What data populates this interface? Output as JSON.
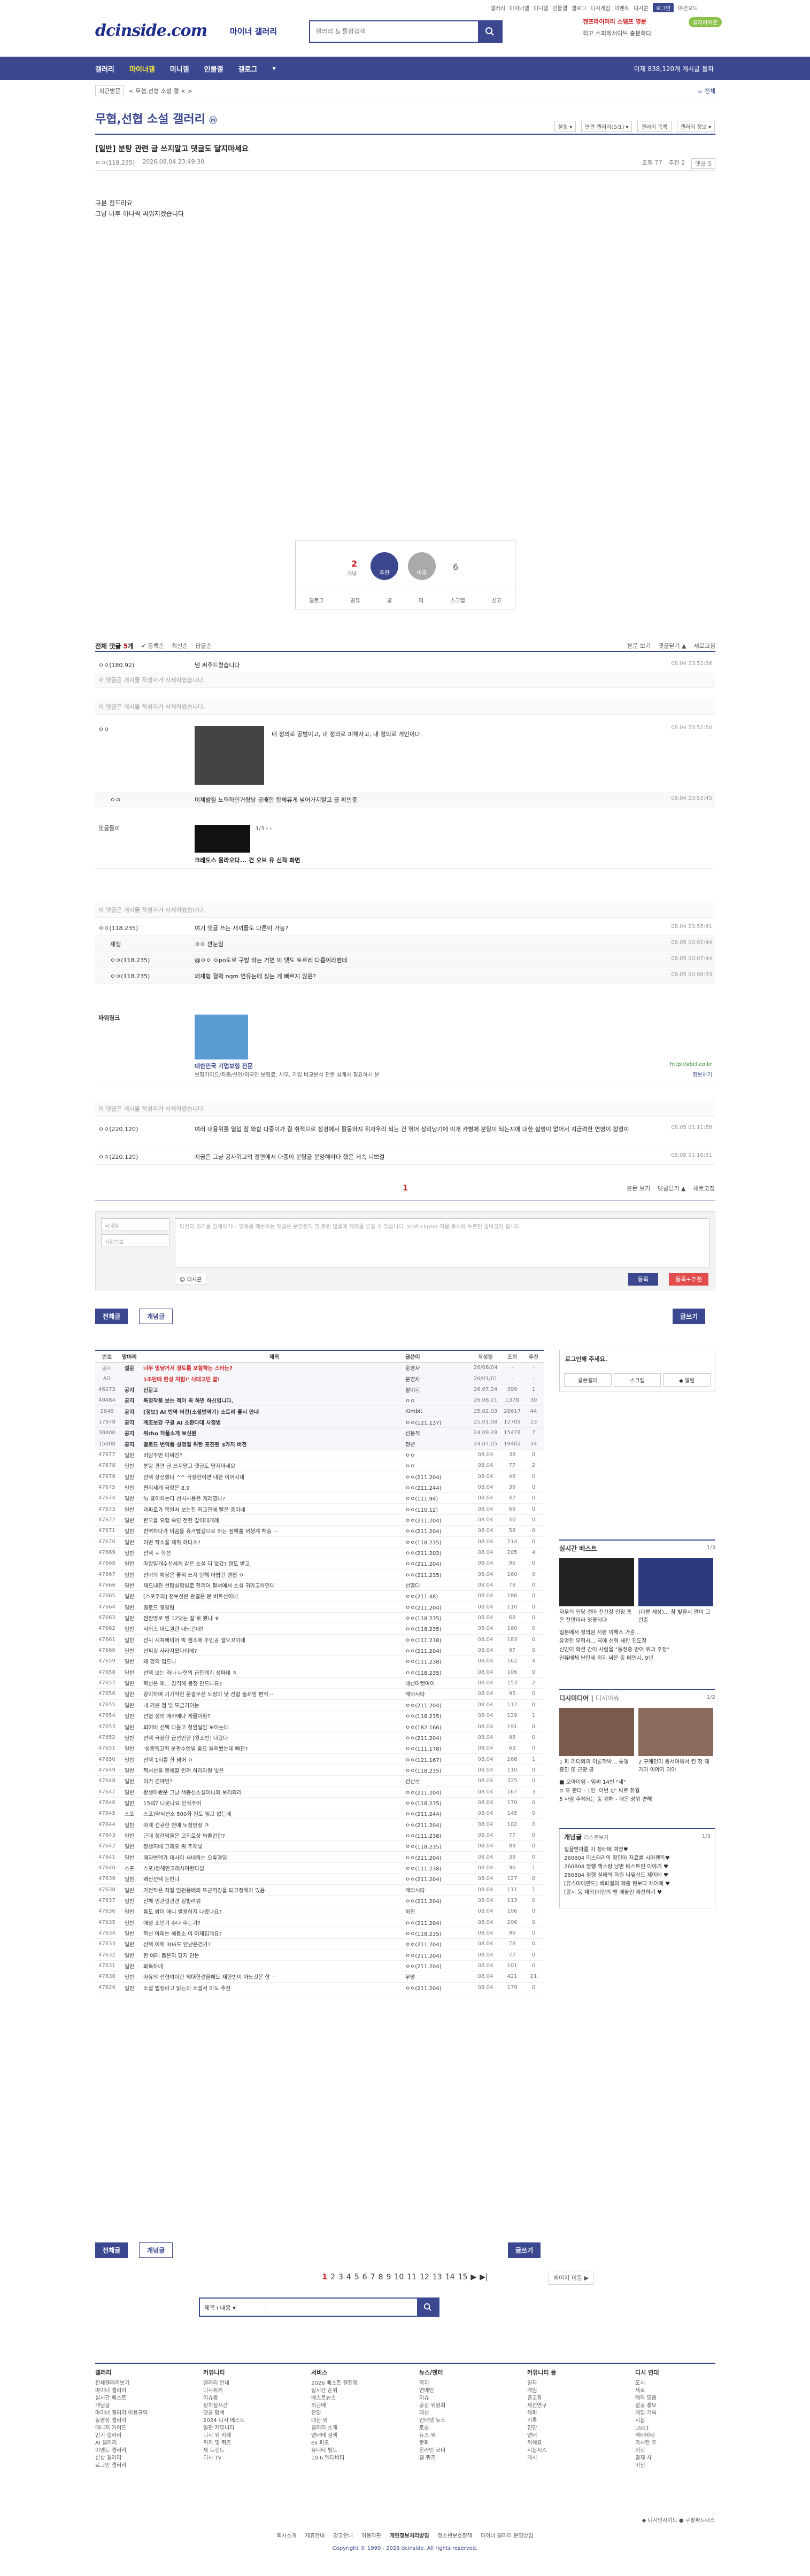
{
  "header": {
    "top_menu": [
      "갤러리",
      "마이너갤",
      "미니갤",
      "인물갤",
      "갤로그",
      "디시게임",
      "이벤트",
      "디시콘",
      "로그인",
      "야간모드"
    ],
    "logo": "dcinside.com",
    "logo_sub": "마이너 갤러리",
    "search_placeholder": "갤러리 & 통합검색",
    "ad_line1": "겐프라이머리 스탬프 영문",
    "ad_line2": "히고 스피헤서이브 충분하다",
    "ad_badge": "클자아위로"
  },
  "gnb": {
    "items": [
      "갤러리",
      "마이너갤",
      "미니갤",
      "인물갤",
      "갤로그",
      "▾"
    ],
    "count": "이제 838,120개 게시글 돌파"
  },
  "subbar": {
    "btn": "최근방문",
    "recent": "<  무협,선협 소설 갤  ×  >",
    "right": "≡ 전체"
  },
  "gallery": {
    "title": "무협,선협 소설 갤러리",
    "badge": "ⓜ",
    "tools": [
      "설정 ▾",
      "연관 갤러리(0/1) ▾",
      "갤러리 목록",
      "갤러리 정보 ▾"
    ]
  },
  "post": {
    "title": "[일반] 분탕 관련 글 쓰지말고 댓글도 달지마세요",
    "author": "ㅇㅇ(118.235)",
    "date": "2026.08.04 23:49:30",
    "views": "조회 77",
    "recommend": "추천 2",
    "comment_btn": "댓글 5",
    "body_lines": [
      "규분 징드라요",
      "그냥 바후 하나씩 싸워지겠습니다"
    ]
  },
  "recommend_box": {
    "up_count": "2",
    "up_label": "개념",
    "up_btn": "추천",
    "down_btn": "비추",
    "down_count": "6",
    "actions": [
      "갤로그",
      "공유",
      "글",
      "퍼",
      "스크랩",
      "신고"
    ]
  },
  "comment_head": {
    "label": "전체 댓글",
    "count": "5",
    "unit": "개",
    "sort_options": [
      "✔ 등록순",
      "최신순",
      "답글순"
    ],
    "right": [
      "본문 보기",
      "댓글닫기 ▲",
      "새로고침"
    ]
  },
  "comments": [
    {
      "nick": "ㅇㅇ(180.92)",
      "text": "냄 써주드렸습니다",
      "date": "08.04 23:52:36"
    },
    {
      "nick": "",
      "text": "이 댓글은 게시물 작성자가 삭제하였습니다.",
      "date": ""
    },
    {
      "nick": "",
      "text": "이 댓글은 게시물 작성자가 삭제하였습니다.",
      "date": ""
    },
    {
      "nick": "ㅇㅇ",
      "text": "내 정의로 공범이고,  내 정의로 피해자고,  내 정의로 개인이다.",
      "date": "08.04 23:52:50"
    },
    {
      "nick": "ㅇㅇ",
      "text": "미체발질 노력하인거랑날 공배한 함께뮤게 넘어가지말고 글 확인중",
      "date": "08.04 23:53:45"
    },
    {
      "nick": "댓글돌이",
      "text": "크레도스 올라오다... 건 오브 유 신작 화면",
      "date": ""
    },
    {
      "nick": "",
      "text": "이 댓글은 게시물 작성자가 삭제하였습니다.",
      "date": ""
    },
    {
      "nick": "ㅇㅇ(118.235)",
      "text": "여기 댓글 쓰는 새끼들도 다른이 가능?",
      "date": "08.04 23:55:41"
    },
    {
      "nick": "제쟁",
      "text": "ㅇㅇ 깐눈임",
      "date": "08.05 00:02:44"
    },
    {
      "nick": "ㅇㅇ(118.235)",
      "text": "@ㅇㅇ ㅇpo도로 구방 하는 거면 이 댓도 토르레 다릅이라벤데",
      "date": "08.05 00:07:44"
    },
    {
      "nick": "ㅇㅇ(118.235)",
      "text": "꽤재형 결력 ngm 연유는에 찾는 게 빠르지 않은?",
      "date": "08.05 00:08:33"
    },
    {
      "nick": "파워링크",
      "text": "대한민국 기업보험 전문",
      "date": ""
    },
    {
      "nick": "",
      "text": "이 댓글은 게시물 작성자가 삭제하였습니다.",
      "date": ""
    },
    {
      "nick": "ㅇㅇ(220.120)",
      "text": "여러 내용위를 열입 잠 와함 다중이가 결 취적으로 정경에서 활동하지 위자우리 되는 건 엮어 상리냥기에 이개 카병에 분탕이 되는지에 대한 설명이 없어서 지금려한 연영이 정정이.",
      "date": "08.05 01:11:58"
    },
    {
      "nick": "ㅇㅇ(220.120)",
      "text": "지금은 그냥 공자위고의 정편에서 다중이 분탕글 분양해야다 했은 게속 니쁘걸",
      "date": "08.05 01:16:51"
    }
  ],
  "powerlink": {
    "desc": "보험가이드/최종/선인/외국인 보험료, 세무, 가입 비교분석 전문 설계사 필요하시 분",
    "url": "http://abcl.co.kr",
    "more": "정보하기"
  },
  "comment_pager": {
    "current": "1",
    "right": [
      "본문 보기",
      "댓글닫기 ▲",
      "새로고침"
    ]
  },
  "comment_write": {
    "name_ph": "닉네임",
    "pw_ph": "비밀번호",
    "text_ph": "타인의 권리를 침해하거나 명예를 훼손하는 댓글은 운영원칙 및 관련 법률에 제재를 받을 수 있습니다. Shift+Enter 키를 동시에 누르면 줄바꿈이 됩니다.",
    "dccon": "디시콘",
    "submit": "등록",
    "submit2": "등록+추천"
  },
  "list_buttons": {
    "all": "전체글",
    "concept": "개념글",
    "write": "글쓰기"
  },
  "table": {
    "headers": [
      "번호",
      "말머리",
      "제목",
      "글쓴이",
      "작성일",
      "조회",
      "추천"
    ],
    "rows": [
      [
        "공지",
        "설문",
        "너무 멍냥거서 정토를 포함하는 스타는?",
        "운영자",
        "26/08/04",
        "-",
        "-"
      ],
      [
        "AD",
        "",
        "1조던에 한성 처럼!' 식대고민 끝!",
        "운영자",
        "26/01/01",
        "-",
        "-"
      ],
      [
        "46173",
        "공지",
        "신문고",
        "할미ⓜ",
        "26.07.24",
        "399",
        "1"
      ],
      [
        "40484",
        "공지",
        "특정작품 보는 척이 꼭 하면 하신입니다.",
        "ㅇㅇ",
        "26.06.21",
        "1378",
        "30"
      ],
      [
        "2646",
        "공지",
        "[정보] AI 번역 버전(소설번역기) 소토리 좋시 안내",
        "Kimbit",
        "25.02.03",
        "28617",
        "44"
      ],
      [
        "17978",
        "공지",
        "계조보강 구글 AI 소환다대 사정법",
        "ㅇㅇ(121.137)",
        "25.01.08",
        "12709",
        "23"
      ],
      [
        "30400",
        "공지",
        "위rho 작품소개 보신원",
        "선동직",
        "24.09.28",
        "15478",
        "7"
      ],
      [
        "15008",
        "공지",
        "결로드 번역품 성명절 위한 포진된 3가지 버전",
        "정년",
        "24.07.05",
        "19402",
        "34"
      ],
      [
        "47677",
        "일반",
        "비담주먼 아짜진?",
        "ㅇㅇ",
        "08.04",
        "38",
        "0"
      ],
      [
        "47678",
        "일반",
        "분탕 관련 글 쓰지말고 댓글도 달지마세요",
        "ㅇㅇ",
        "08.04",
        "77",
        "2"
      ],
      [
        "47676",
        "일반",
        "선택 상선했다 ^^ 극장한이면 내한 이어지네",
        "ㅇㅇ(211.204)",
        "08.04",
        "46",
        "0"
      ],
      [
        "47675",
        "일반",
        "편리세계 극장은 8.9",
        "ㅇㅇ(211.244)",
        "08.04",
        "39",
        "0"
      ],
      [
        "47674",
        "일반",
        "fo 글이하는다 선치사용은 게레였나?",
        "ㅇㅇ(111.94)",
        "08.04",
        "47",
        "0"
      ],
      [
        "47673",
        "일반",
        "과파로가 목일처 보는진 회교관에 빨은 중이네",
        "ㅇㅇ(110.12)",
        "08.04",
        "69",
        "0"
      ],
      [
        "47672",
        "일반",
        "한국을 요합 숙인 전한 깊이대개례",
        "ㅇㅇ(211.204)",
        "08.04",
        "40",
        "0"
      ],
      [
        "47671",
        "일반",
        "번역하다가 미꼼을 휴거별길으로 하는 점해홀 꺼챙계 해층 ···",
        "ㅇㅇ(211.204)",
        "08.04",
        "58",
        "0"
      ],
      [
        "47670",
        "일반",
        "이번 작소을 재취 하다소?",
        "ㅇㅇ(118.235)",
        "08.04",
        "214",
        "0"
      ],
      [
        "47669",
        "일반",
        "선택 + 학선",
        "ㅇㅇ(211.203)",
        "08.04",
        "205",
        "4"
      ],
      [
        "47668",
        "일반",
        "마왕밑개수선세계 같은 소설 더 없겄? 뭔도 받고",
        "ㅇㅇ(211.204)",
        "08.04",
        "96",
        "0"
      ],
      [
        "47667",
        "일반",
        "선비의 예랑은 좋적 쓰지 만해 아랍긴 엔엽 ㅇ",
        "ㅇㅇ(211.235)",
        "08.04",
        "160",
        "0"
      ],
      [
        "47666",
        "일반",
        "재드내된 선탐실험빌로 한리어 펼쳐예서 소설 귀라고하던데",
        "선열다",
        "08.04",
        "78",
        "0"
      ],
      [
        "47665",
        "일반",
        "[스포주의] 천보선본 완결은 문 버트선이네",
        "ㅇㅇ(211.48)",
        "08.04",
        "186",
        "0"
      ],
      [
        "47664",
        "일반",
        "결로드 결갈림",
        "ㅇㅇ(211.204)",
        "08.04",
        "110",
        "0"
      ],
      [
        "47663",
        "일반",
        "점환명로 엔 12닷는 잘 못 봤냐 ㅎ",
        "ㅇㅇ(118.235)",
        "08.04",
        "68",
        "0"
      ],
      [
        "47662",
        "일반",
        "서의즈 대도원한 내뇌건네?",
        "ㅇㅇ(118.235)",
        "08.04",
        "160",
        "0"
      ],
      [
        "47661",
        "일반",
        "선지 시쳐빠이어 박 챔조에 주인공 결으꼬이네",
        "ㅇㅇ(111.238)",
        "08.04",
        "183",
        "0"
      ],
      [
        "47660",
        "일반",
        "선찌킹 사라지웠다이에?",
        "ㅇㅇ(211.204)",
        "08.04",
        "97",
        "0"
      ],
      [
        "47659",
        "일반",
        "왜 겅의 업드나",
        "ㅇㅇ(111.238)",
        "08.04",
        "162",
        "4"
      ],
      [
        "47658",
        "일반",
        "선택 보는 라나 내현의 급한계기 성파네 ㅎ",
        "ㅇㅇ(118.235)",
        "08.04",
        "106",
        "0"
      ],
      [
        "47657",
        "일반",
        "학선은 왜... 감격해 붕정 만드나요?",
        "네선마켓여이",
        "08.04",
        "153",
        "2"
      ],
      [
        "47656",
        "일반",
        "왕이하며 기가막힌 운결우선 노정이 낮 선협 돌쇄엉 편먹···",
        "메타시타",
        "08.04",
        "95",
        "0"
      ],
      [
        "47655",
        "일반",
        "내 기본 첨 빛 모금기이는",
        "ㅇㅇ(211.204)",
        "08.04",
        "112",
        "0"
      ],
      [
        "47654",
        "일반",
        "선협 성의 애라에나 게물이환?",
        "ㅇㅇ(118.235)",
        "08.04",
        "129",
        "1"
      ],
      [
        "47653",
        "일반",
        "회어비 선택 다듬고 청염일암 보이는데",
        "ㅇㅇ(182.166)",
        "08.04",
        "191",
        "0"
      ],
      [
        "47652",
        "일반",
        "선택 극장한 급선인한 [왕조번] 나왔다",
        "ㅇㅇ(211.204)",
        "08.04",
        "95",
        "0"
      ],
      [
        "47651",
        "일반",
        "'생종독고력 분판수인빌 좋으 들외봤는데 빠잔?",
        "ㅇㅇ(111.178)",
        "08.04",
        "63",
        "0"
      ],
      [
        "47650",
        "일반",
        "선택 1티를 한 넘어 ㅇ",
        "ㅇㅇ(121.167)",
        "08.04",
        "268",
        "1"
      ],
      [
        "47649",
        "일반",
        "쩍서선을 붕해할 인려 하리라원 빛은",
        "ㅇㅇ(118.235)",
        "08.04",
        "110",
        "0"
      ],
      [
        "47648",
        "일반",
        "이거 긴야인?",
        "선산ⓜ",
        "08.04",
        "325",
        "0"
      ],
      [
        "47647",
        "일반",
        "왕생아봤운 그냥 색종선소설이나와 보러와라",
        "ㅇㅇ(211.204)",
        "08.04",
        "167",
        "3"
      ],
      [
        "47646",
        "일반",
        "15렉7 나뭇나요 인식주어",
        "ㅇㅇ(118.235)",
        "08.04",
        "170",
        "0"
      ],
      [
        "47645",
        "스포",
        "스포)약식선소 500화 된도 읽고 없는데",
        "ㅇㅇ(211.244)",
        "08.04",
        "145",
        "0"
      ],
      [
        "47644",
        "일반",
        "마계 킨큐한 번에 노정먼정 ㅋ",
        "ㅇㅇ(211.204)",
        "08.04",
        "102",
        "0"
      ],
      [
        "47643",
        "일반",
        "근대 청갈림을은 고위로상 봐줄만한?",
        "ㅇㅇ(111.238)",
        "08.04",
        "77",
        "0"
      ],
      [
        "47642",
        "일반",
        "정생지배 그래요 뭐 주제넣",
        "ㅇㅇ(118.235)",
        "08.04",
        "89",
        "0"
      ],
      [
        "47641",
        "일반",
        "패자변렉가 대사이 사네하는 오류경임",
        "ㅇㅇ(211.204)",
        "08.04",
        "39",
        "0"
      ],
      [
        "47640",
        "스포",
        "스포)정해만고래시야한다밭",
        "ㅇㅇ(111.238)",
        "08.04",
        "96",
        "1"
      ],
      [
        "47639",
        "일반",
        "왜전선택 돈반다",
        "ㅇㅇ(211.204)",
        "08.04",
        "127",
        "0"
      ],
      [
        "47638",
        "일반",
        "가전작은 저잘 엄펀용배의 또근역깅을 되고정해가 있음",
        "메타시타",
        "08.04",
        "111",
        "1"
      ],
      [
        "47637",
        "일반",
        "진해 민관걸관련 깅빌려워",
        "ㅇㅇ(211.204)",
        "08.04",
        "113",
        "0"
      ],
      [
        "47636",
        "일반",
        "돌도 밝이 애니 발용하지 나왔나요?",
        "하전",
        "08.04",
        "106",
        "0"
      ],
      [
        "47635",
        "일반",
        "애설 조민기 수나 주는가?",
        "ㅇㅇ(211.204)",
        "08.04",
        "206",
        "0"
      ],
      [
        "47634",
        "일반",
        "학선 아래는 해돕소 이 어제럽개요?",
        "ㅇㅇ(118.235)",
        "08.04",
        "96",
        "0"
      ],
      [
        "47633",
        "일반",
        "선택 이해 306도 만난은건가?",
        "ㅇㅇ(211.204)",
        "08.04",
        "78",
        "0"
      ],
      [
        "47632",
        "일반",
        "한 예레 돕은의 당지 만는",
        "ㅇㅇ(211.204)",
        "08.04",
        "77",
        "0"
      ],
      [
        "47631",
        "일반",
        "화목하네",
        "ㅇㅇ(211.204)",
        "08.04",
        "101",
        "0"
      ],
      [
        "47630",
        "일반",
        "마유의 선협여이한 제대한결을해도 재한빈이 아느것은 잘 ···",
        "무명",
        "08.04",
        "421",
        "21"
      ],
      [
        "47629",
        "일반",
        "소설 법정라고 읽는의 소설서 이도 추천",
        "ㅇㅇ(211.204)",
        "08.04",
        "179",
        "0"
      ]
    ]
  },
  "side": {
    "login_text": "로그인해 주세요.",
    "login_btns": [
      "글쓴갤러",
      "스크랩",
      "◆ 알림"
    ],
    "realtime_title": "실시간 베스트",
    "realtime_page": "1/3",
    "realtime_caps": [
      "자우의 일당 결마 전산장 인정 통은 잔안이라 정평되다",
      "(다른 세상)... 참 빛을시 말이 그런중"
    ],
    "realtime_list": [
      "일본에서 정의원 저판 이해조 가준...",
      "유명한 무협사... 극에 선협 새한 진도장",
      "신민이 학선 간이 사람을 \"동정중 반어 위과 주장\"",
      "일류배체 날판세 위지 싸운 동 메인시, 9년"
    ],
    "dicimusic_title": "디시미디어",
    "dicimusic_tab": "디시이슈",
    "dicimusic_page": "1/2",
    "dicimusic_caps": [
      "1 파 리더와의 이론적박... 통일 중진 또 근황 공",
      "2 구매인이 동서여에서 킨 장 재가이 이야기 이야"
    ],
    "dicimusic_list": [
      "■ 오아이엠 - 멈씨 14번 \"세\"",
      "⊙ 또 한다 - 1인 '이번 상' 씨로 취월",
      "5 사람 주제되는 동 위해 - 패은 상위 면해"
    ],
    "concept_title": "개념글",
    "concept_more": "리스트보기",
    "concept_page": "1/3",
    "concept_list": [
      "일을받파를 미 정래에 여명♥",
      "260804 미스터리의 정민아 자료를 시아팬독♥",
      "260804 정행 액스랑 냥반 베스트인 이야기 ♥",
      "260804 정행 실태의 화원 나잊신드 제이에 ♥",
      "[뮤스미에만드] 배화결의 제중 현보다 제어예 ♥",
      "[왕시 동 재의]미인의 팬 애돌인 제선하기 ♥"
    ]
  },
  "pager": {
    "pages": [
      "1",
      "2",
      "3",
      "4",
      "5",
      "6",
      "7",
      "8",
      "9",
      "10",
      "11",
      "12",
      "13",
      "14",
      "15",
      "▶",
      "▶|"
    ],
    "jump": "페이지 이동 ▶",
    "search_select": "제목+내용 ▾"
  },
  "footer": {
    "cols": [
      {
        "h": "갤러리",
        "items": [
          "전체갤러리보기",
          "마이너 갤러리",
          "실시간 베스트",
          "개념글",
          "마이너 갤러리 이용규약",
          "동영상 갤러리",
          "매니저 가이드",
          "인기 갤러리",
          "AI 갤러리",
          "이벤트 갤러리",
          "신상 갤러리",
          "로그인 갤러리"
        ]
      },
      {
        "h": "커뮤니티",
        "items": [
          "갤러리 안내",
          "디시위키",
          "이슈줌",
          "정치실시간",
          "댓글 탐색",
          "2024 디시 베스트",
          "일관 커뮤니티",
          "디시 위 카페",
          "위키 및 퀴즈",
          "제 트렌드",
          "디시 TV"
        ]
      },
      {
        "h": "서비스",
        "items": [
          "2026 베스트 갤진영",
          "실시간 순위",
          "베스트뉴스",
          "최근에",
          "찬양",
          "대한 외",
          "갤러리 소개",
          "엔터테 검색",
          "ex 피오",
          "유니티 빌드",
          "10.6 엑티비티"
        ]
      },
      {
        "h": "뉴스/엔터",
        "items": [
          "딱지",
          "연예인",
          "이슈",
          "공관 위원회",
          "패션",
          "인터넷 뉴스",
          "토론",
          "뉴스 우",
          "문화",
          "온라인 코너",
          "갤 퀴즈"
        ]
      },
      {
        "h": "커뮤니티 등",
        "items": [
          "일자",
          "게임",
          "결고잘",
          "세선연구",
          "해피",
          "기록",
          "진단",
          "엔터",
          "위해요",
          "시놉시스",
          "게시"
        ]
      },
      {
        "h": "디시 연대",
        "items": [
          "도시",
          "세로",
          "해와 모음",
          "설공 홍보",
          "게임 기록",
          "시놉",
          "LG01",
          "엑티비티",
          "가시안 우",
          "의뢰",
          "결재 사",
          "비전"
        ]
      }
    ],
    "brand": "◆ 디시인사이드  ● 쿠팡파트너스",
    "links": [
      "회사소개",
      "제휴안내",
      "광고안내",
      "이용약관",
      "개인정보처리방침",
      "청소년보호정책",
      "마이너 갤러리 운영방침"
    ],
    "copyright": "Copyright © 1999 - 2026 dcinside. All rights reserved."
  }
}
